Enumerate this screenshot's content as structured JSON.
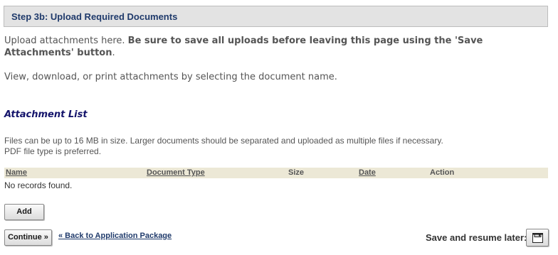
{
  "step_header": {
    "title": "Step 3b: Upload Required Documents"
  },
  "intro": {
    "lead": "Upload attachments here. ",
    "emphasis": "Be sure to save all uploads before leaving this page using the 'Save Attachments' button",
    "end": "."
  },
  "view_text": "View, download, or print attachments by selecting the document name.",
  "attachment_list": {
    "title": "Attachment List",
    "note_line1": "Files can be up to 16 MB in size. Larger documents should be separated and uploaded as multiple files if necessary.",
    "note_line2": "PDF file type is preferred.",
    "columns": [
      "Name",
      "Document Type",
      "Size",
      "Date",
      "Action"
    ],
    "empty_message": "No records found.",
    "add_label": "Add"
  },
  "footer": {
    "continue_label": "Continue »",
    "back_link": "« Back to Application Package",
    "save_resume_label": "Save and resume later:",
    "save_icon": "floppy-disk-icon"
  }
}
